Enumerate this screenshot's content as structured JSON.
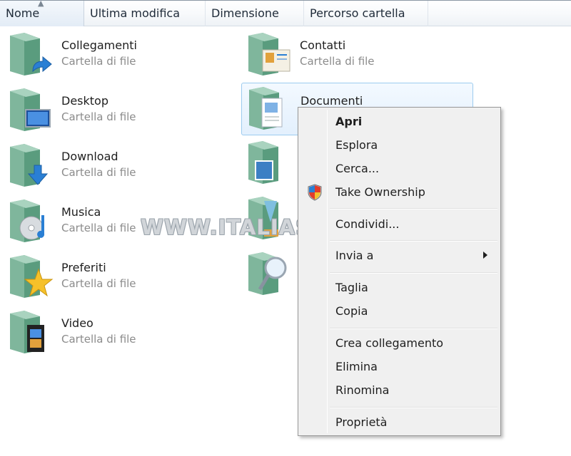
{
  "header": {
    "columns": [
      "Nome",
      "Ultima modifica",
      "Dimensione",
      "Percorso cartella"
    ]
  },
  "folders": [
    {
      "name": "Collegamenti",
      "type": "Cartella di file",
      "icon": "shortcut-folder-icon"
    },
    {
      "name": "Contatti",
      "type": "Cartella di file",
      "icon": "contacts-folder-icon"
    },
    {
      "name": "Desktop",
      "type": "Cartella di file",
      "icon": "desktop-folder-icon"
    },
    {
      "name": "Documenti",
      "type": "",
      "icon": "documents-folder-icon"
    },
    {
      "name": "Download",
      "type": "Cartella di file",
      "icon": "download-folder-icon"
    },
    {
      "name": "Musica",
      "type": "Cartella di file",
      "icon": "music-folder-icon"
    },
    {
      "name": "Preferiti",
      "type": "Cartella di file",
      "icon": "favorites-folder-icon"
    },
    {
      "name": "Video",
      "type": "Cartella di file",
      "icon": "video-folder-icon"
    }
  ],
  "watermark": "WWW.ITALIASW.COM",
  "context_menu": {
    "items": [
      "Apri",
      "Esplora",
      "Cerca...",
      "Take Ownership",
      "Condividi...",
      "Invia a",
      "Taglia",
      "Copia",
      "Crea collegamento",
      "Elimina",
      "Rinomina",
      "Proprietà"
    ]
  },
  "colors": {
    "selection_border": "#9ccbef",
    "menu_bg": "#f0f0f0"
  }
}
